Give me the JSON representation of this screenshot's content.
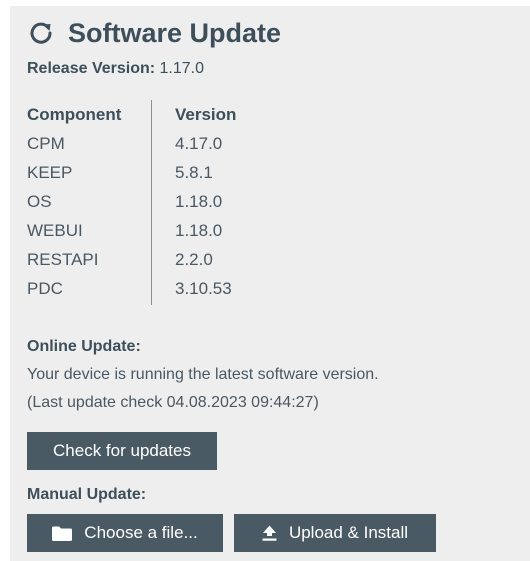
{
  "header": {
    "title": "Software Update",
    "icon": "refresh-icon"
  },
  "release": {
    "label": "Release Version:",
    "value": "1.17.0"
  },
  "components": {
    "headers": [
      "Component",
      "Version"
    ],
    "rows": [
      [
        "CPM",
        "4.17.0"
      ],
      [
        "KEEP",
        "5.8.1"
      ],
      [
        "OS",
        "1.18.0"
      ],
      [
        "WEBUI",
        "1.18.0"
      ],
      [
        "RESTAPI",
        "2.2.0"
      ],
      [
        "PDC",
        "3.10.53"
      ]
    ]
  },
  "online_update": {
    "label": "Online Update:",
    "status": "Your device is running the latest software version.",
    "last_check": "(Last update check 04.08.2023 09:44:27)",
    "check_button": "Check for updates"
  },
  "manual_update": {
    "label": "Manual Update:",
    "choose_button": "Choose a file...",
    "choose_icon": "folder-icon",
    "upload_button": "Upload & Install",
    "upload_icon": "upload-icon"
  },
  "colors": {
    "panel_bg": "#eeeeee",
    "button_bg": "#4a5a64",
    "text": "#3d4f5b"
  }
}
